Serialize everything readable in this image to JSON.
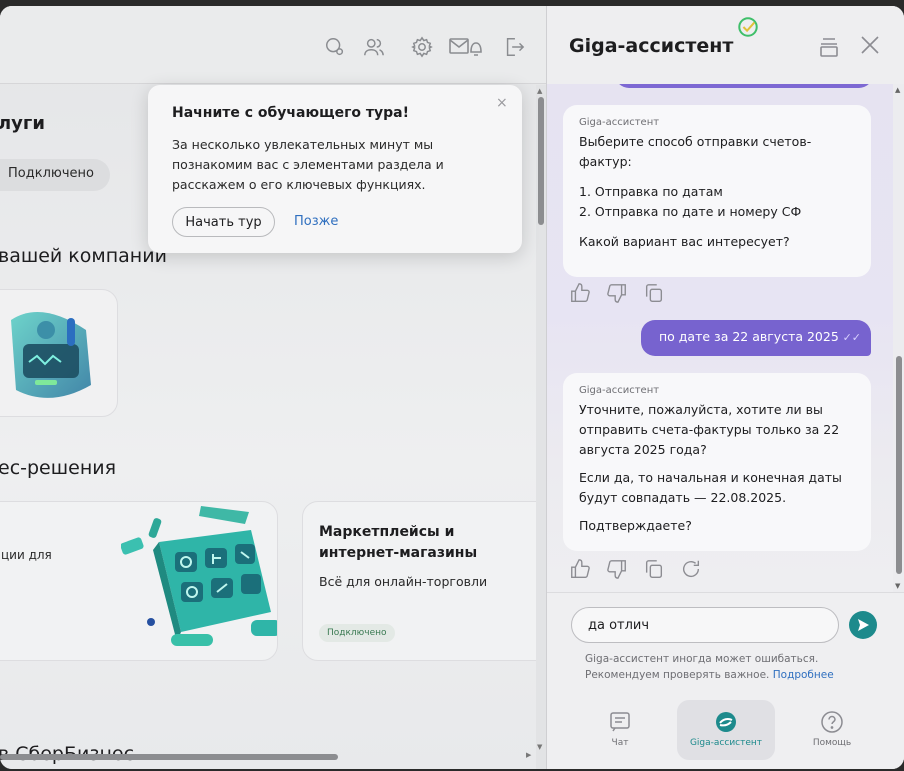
{
  "left": {
    "services_heading": "луги",
    "connected_pill": "Подключено",
    "company_heading": "вашей компании",
    "biz_heading": "ес-решения",
    "card_big_text": "ции для",
    "marketplace": {
      "title": "Маркетплейсы и интернет-магазины",
      "subtitle": "Всё для онлайн-торговли",
      "badge": "Подключено"
    },
    "sber_heading": "в СберБизнес"
  },
  "tour": {
    "title": "Начните с обучающего тура!",
    "body": "За несколько увлекательных минут мы познакомим вас с элементами раздела и расскажем о его ключевых функциях.",
    "start_button": "Начать тур",
    "later_link": "Позже",
    "close": "×"
  },
  "assistant": {
    "title": "Giga-ассистент",
    "messages": [
      {
        "role": "assistant",
        "sender": "Giga-ассистент",
        "paragraphs": [
          "Выберите способ отправки счетов-фактур:",
          "1. Отправка по датам\n2. Отправка по дате и номеру СФ",
          "Какой вариант вас интересует?"
        ]
      },
      {
        "role": "user",
        "text": "по дате за 22 августа 2025",
        "status": "✓✓"
      },
      {
        "role": "assistant",
        "sender": "Giga-ассистент",
        "paragraphs": [
          "Уточните, пожалуйста, хотите ли вы отправить счета-фактуры только за 22 августа 2025 года?",
          "Если да, то начальная и конечная даты будут совпадать — 22.08.2025.",
          "Подтверждаете?"
        ]
      }
    ],
    "input_value": "да отлич",
    "disclaimer_text": "Giga-ассистент иногда может ошибаться. Рекомендуем проверять важное.",
    "disclaimer_link": "Подробнее",
    "nav": [
      {
        "label": "Чат",
        "icon": "chat-icon"
      },
      {
        "label": "Giga-ассистент",
        "icon": "giga-logo-icon"
      },
      {
        "label": "Помощь",
        "icon": "help-icon"
      }
    ]
  },
  "colors": {
    "accent_purple": "#7763cf",
    "accent_teal": "#1d8a8c",
    "link_blue": "#2f6fbf"
  }
}
